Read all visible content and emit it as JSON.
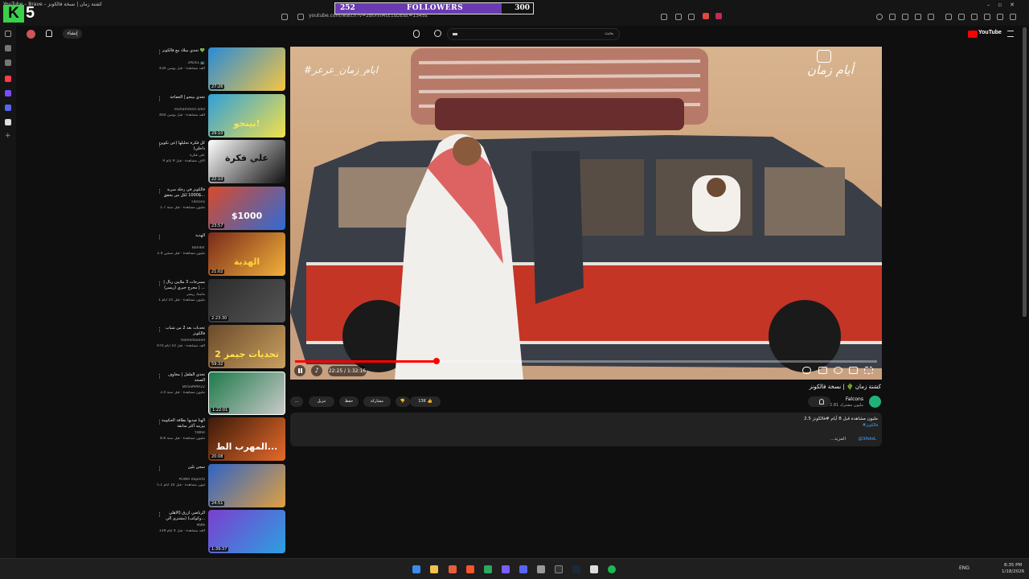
{
  "window": {
    "title": "YouTube – Brave – كشتة زمان | نسخة فالكونز"
  },
  "browser": {
    "url": "youtube.com/watch?v=2B0nifMtE1sDE&t=1345s"
  },
  "overlay": {
    "logo_letter": "K",
    "logo_digit": "5",
    "followers_current": "252",
    "followers_label": "FOLLOWERS",
    "followers_goal": "300",
    "followers_progress": 0.84
  },
  "youtube": {
    "search_placeholder": "بحث",
    "create_label": "إنشاء",
    "logo_text": "YouTube"
  },
  "player": {
    "hashtag": "#ايام_زمان_عرعر",
    "brand": "أيام زمان",
    "time": "22:25 / 1:32:16",
    "progress": 0.243
  },
  "video": {
    "title": "كشتة زمان 🌵 | نسخة فالكونز",
    "channel": "Falcons",
    "subs": "2.81 مليون مشترك",
    "like_count": "13K",
    "dislike_label": "",
    "share_label": "مشاركة",
    "save_label": "حفظ",
    "download_label": "تنزيل",
    "more_label": "...",
    "views": "2.5 مليون مشاهدة قبل 8 أيام #فالكونز",
    "tag": "#فالكونز",
    "handle": "@3AdeL",
    "more": "...المزيد"
  },
  "recommendations": [
    {
      "title": "تحدي ميلاد مع فالكونز 💚",
      "channel": "3ADEL 📺",
      "meta": "430 ألف مشاهدة · قبل يومين",
      "duration": "27:26",
      "thumb_text": ""
    },
    {
      "title": "تحدي بينجو | الخفاجة",
      "channel": "mohammed adel",
      "meta": "460 ألف مشاهدة · قبل يومين",
      "duration": "29:10",
      "thumb_text": "بينجو!"
    },
    {
      "title": "كل فكرة تحليلها (عن تكوين داخلي)",
      "channel": "علي فكرة",
      "meta": "9 آلاف مشاهدة · قبل 9 أيام",
      "duration": "22:10",
      "thumb_text": "علي فكرة"
    },
    {
      "title": "فالكونز في رحلة سرية $1000 لكل من يحقق...",
      "channel": "Falcons",
      "meta": "1.7 مليون مشاهدة · قبل سنة",
      "duration": "23:57",
      "thumb_text": "$1000"
    },
    {
      "title": "الهدية",
      "channel": "Bander",
      "meta": "2.4 مليون مشاهدة · قبل سنتين",
      "duration": "21:02",
      "thumb_text": "الهدية"
    },
    {
      "title": "مسرحات 3 ملايين ريال | محرج جبري (ريسر) | ...",
      "channel": "ماسك ريسر",
      "meta": "1 مليون مشاهدة · قبل 10 أيام",
      "duration": "2:23:30",
      "thumb_text": ""
    },
    {
      "title": "تحديات بعد 2 من شباب فالكونز",
      "channel": "HamedSaeed",
      "meta": "970 ألف مشاهدة · قبل 10 أيام",
      "duration": "59:32",
      "thumb_text": "تحديات جيمز 2"
    },
    {
      "title": "تحدي الفلفل | مخاوف الصحة",
      "channel": "BOSSMAR22",
      "meta": "3.4 مليون مشاهدة · قبل سنة",
      "duration": "1:22:01",
      "thumb_text": ""
    },
    {
      "title": "الهنا صديها بطاقة الحكومة بيزنيه أكثر سابقة",
      "channel": "YWAR",
      "meta": "8.8 مليون مشاهدة · قبل سنة",
      "duration": "20:08",
      "thumb_text": "المهرب الط..."
    },
    {
      "title": "سجن بلين",
      "channel": "POWR eSports",
      "meta": "5.1 مليون مشاهدة · قبل 10 أيام",
      "duration": "24:51",
      "thumb_text": ""
    },
    {
      "title": "الرياضي أزرق (الأهلي وكوكب) (مشترى الي...",
      "channel": "MiMi",
      "meta": "139 ألف مشاهدة · قبل 4 أيام",
      "duration": "1:39:37",
      "thumb_text": ""
    }
  ],
  "taskbar": {
    "lang": "ENG",
    "time": "8:35 PM",
    "date": "1/18/2026"
  },
  "colors": {
    "accent_red": "#ff0000",
    "brand_purple": "#6a3bb0",
    "k5_green": "#39d14a"
  }
}
